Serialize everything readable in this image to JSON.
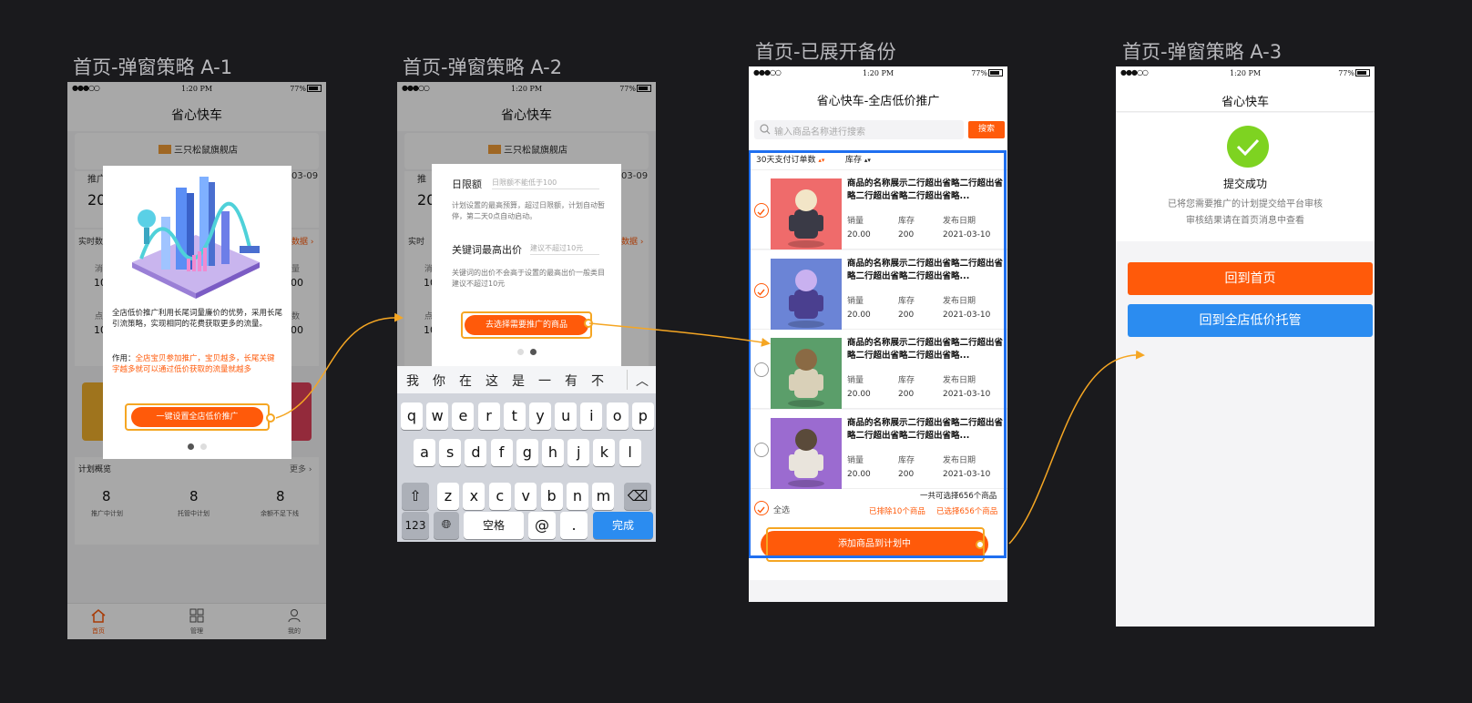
{
  "frames": [
    {
      "title": "首页-弹窗策略 A-1"
    },
    {
      "title": "首页-弹窗策略 A-2"
    },
    {
      "title": "首页-已展开备份"
    },
    {
      "title": "首页-弹窗策略 A-3"
    }
  ],
  "status_bar": {
    "signal": "●●●○○",
    "time": "1:20 PM",
    "battery": "77%"
  },
  "screen1": {
    "nav_title": "省心快车",
    "store_name": "三只松鼠旗舰店",
    "bg_promo_label": "推广",
    "bg_date": "03-09",
    "bg_value": "20",
    "bg_realtime": "实时数",
    "bg_data_link": "数据",
    "bg_col_left_label": "消",
    "bg_col_left_value": "10",
    "bg_col_right_label": "量",
    "bg_col_right_value": "00",
    "bg_col_left_label2": "点",
    "bg_col_left_value2": "10",
    "bg_col_right_label2": "数",
    "bg_col_right_value2": "00",
    "popup_text": "全店低价推广利用长尾词量廉价的优势，采用长尾引流策略，实现相同的花费获取更多的流量。",
    "popup_effect_label": "作用：",
    "popup_effect_text": "全店宝贝参加推广，宝贝越多，长尾关键字越多就可以通过低价获取的流量就越多",
    "popup_button": "一键设置全店低价推广",
    "plan_overview": "计划概览",
    "more": "更多",
    "stats": [
      {
        "value": "8",
        "label": "推广中计划"
      },
      {
        "value": "8",
        "label": "托管中计划"
      },
      {
        "value": "8",
        "label": "余额不足下线"
      }
    ],
    "tabs": [
      {
        "label": "首页",
        "icon": "home-icon"
      },
      {
        "label": "管理",
        "icon": "grid-icon"
      },
      {
        "label": "我的",
        "icon": "user-icon"
      }
    ]
  },
  "screen2": {
    "nav_title": "省心快车",
    "store_name": "三只松鼠旗舰店",
    "bg_promo_label": "推",
    "bg_date": "03-09",
    "bg_value": "20",
    "bg_realtime": "实时",
    "bg_data_link": "数据",
    "bg_col_left_label": "消",
    "bg_col_left_value": "10",
    "bg_col_left_label2": "点",
    "bg_col_left_value2": "10",
    "daily_label": "日限额",
    "daily_placeholder": "日限额不能低于100",
    "daily_desc": "计划设置的最高预算，超过日限额，计划自动暂停，第二天0点自动启动。",
    "kw_label": "关键词最高出价",
    "kw_placeholder": "建议不超过10元",
    "kw_desc": "关键词的出价不会高于设置的最高出价一般类目建议不超过10元",
    "button": "去选择需要推广的商品",
    "candidates": [
      "我",
      "你",
      "在",
      "这",
      "是",
      "一",
      "有",
      "不"
    ],
    "row1": [
      "q",
      "w",
      "e",
      "r",
      "t",
      "y",
      "u",
      "i",
      "o",
      "p"
    ],
    "row2": [
      "a",
      "s",
      "d",
      "f",
      "g",
      "h",
      "j",
      "k",
      "l"
    ],
    "row3": [
      "z",
      "x",
      "c",
      "v",
      "b",
      "n",
      "m"
    ],
    "key_123": "123",
    "key_space": "空格",
    "key_at": "@",
    "key_dot": ".",
    "key_done": "完成"
  },
  "screen3": {
    "nav_title": "省心快车-全店低价推广",
    "search_placeholder": "输入商品名称进行搜索",
    "search_button": "搜索",
    "sort_orders": "30天支付订单数",
    "sort_stock": "库存",
    "items": [
      {
        "title": "商品的名称展示二行超出省略二行超出省略二行超出省略二行超出省略...",
        "sales_label": "销量",
        "stock_label": "库存",
        "date_label": "发布日期",
        "sales": "20.00",
        "stock": "200",
        "date": "2021-03-10",
        "checked": true
      },
      {
        "title": "商品的名称展示二行超出省略二行超出省略二行超出省略二行超出省略...",
        "sales_label": "销量",
        "stock_label": "库存",
        "date_label": "发布日期",
        "sales": "20.00",
        "stock": "200",
        "date": "2021-03-10",
        "checked": true
      },
      {
        "title": "商品的名称展示二行超出省略二行超出省略二行超出省略二行超出省略...",
        "sales_label": "销量",
        "stock_label": "库存",
        "date_label": "发布日期",
        "sales": "20.00",
        "stock": "200",
        "date": "2021-03-10",
        "checked": false
      },
      {
        "title": "商品的名称展示二行超出省略二行超出省略二行超出省略二行超出省略...",
        "sales_label": "销量",
        "stock_label": "库存",
        "date_label": "发布日期",
        "sales": "20.00",
        "stock": "200",
        "date": "2021-03-10",
        "checked": false
      }
    ],
    "select_all": "全选",
    "total_text": "一共可选择656个商品",
    "excluded_text": "已排除10个商品",
    "selected_text": "已选择656个商品",
    "add_button": "添加商品到计划中"
  },
  "screen4": {
    "nav_title": "省心快车",
    "success_title": "提交成功",
    "success_line1": "已将您需要推广的计划提交给平台审核",
    "success_line2": "审核结果请在首页消息中查看",
    "home_button": "回到首页",
    "manage_button": "回到全店低价托管"
  },
  "colors": {
    "accent": "#ff5a0a",
    "blue": "#2b8cf0",
    "success": "#7ed321",
    "highlight": "#f5a623",
    "selection": "#1f6ff0"
  }
}
